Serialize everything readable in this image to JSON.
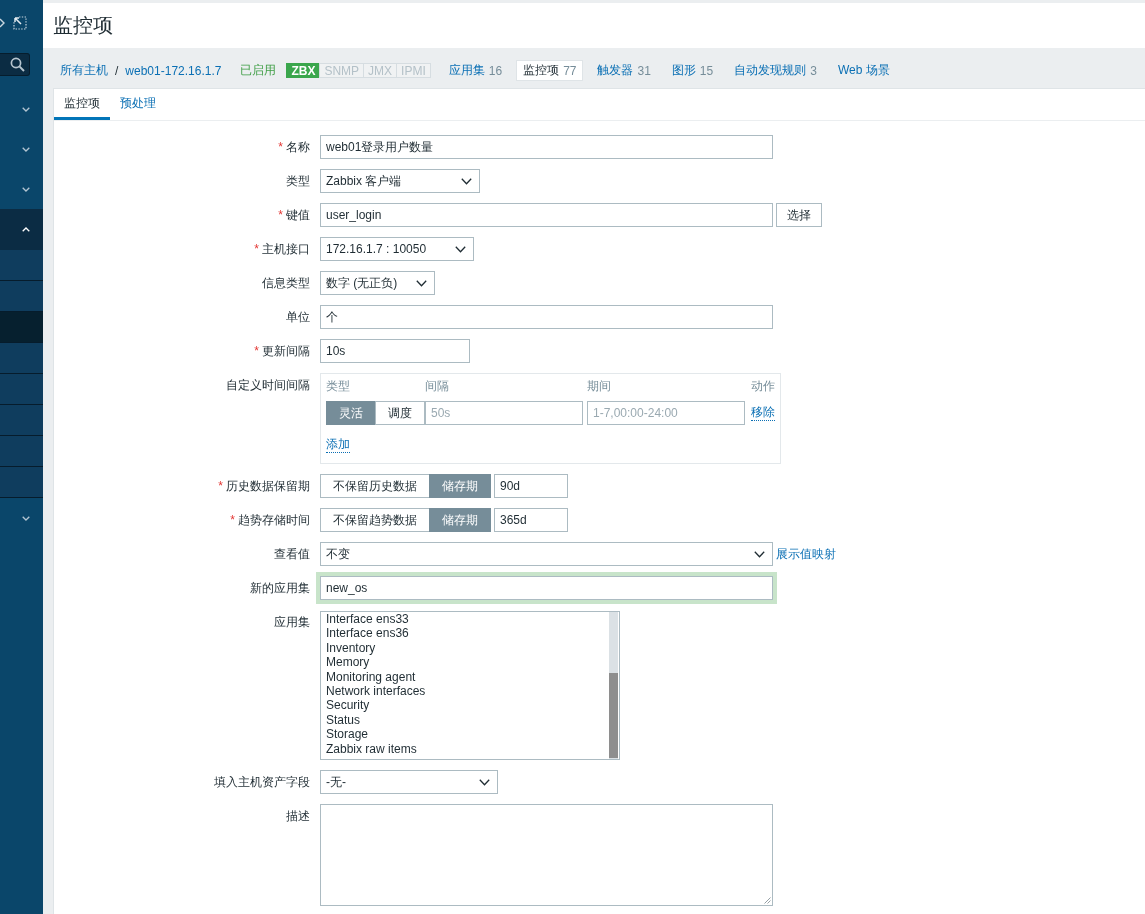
{
  "sidebar": {
    "sections": [
      {
        "expanded": false
      },
      {
        "expanded": false
      },
      {
        "expanded": false
      },
      {
        "expanded": true,
        "items": [
          {
            "selected": false
          },
          {
            "selected": false
          },
          {
            "selected": true
          },
          {
            "selected": false
          },
          {
            "selected": false
          },
          {
            "selected": false
          },
          {
            "selected": false
          },
          {
            "selected": false
          }
        ]
      },
      {
        "expanded": false
      }
    ]
  },
  "page_title": "监控项",
  "breadcrumbs": {
    "items": [
      "所有主机",
      "web01-172.16.1.7"
    ],
    "separator": "/"
  },
  "host_status": "已启用",
  "availability": [
    {
      "label": "ZBX",
      "active": true
    },
    {
      "label": "SNMP",
      "active": false
    },
    {
      "label": "JMX",
      "active": false
    },
    {
      "label": "IPMI",
      "active": false
    }
  ],
  "nav_tabs": [
    {
      "label": "应用集",
      "count": "16",
      "selected": false
    },
    {
      "label": "监控项",
      "count": "77",
      "selected": true
    },
    {
      "label": "触发器",
      "count": "31",
      "selected": false
    },
    {
      "label": "图形",
      "count": "15",
      "selected": false
    },
    {
      "label": "自动发现规则",
      "count": "3",
      "selected": false
    },
    {
      "label": "Web 场景",
      "selected": false
    }
  ],
  "tabs": [
    {
      "label": "监控项",
      "selected": true
    },
    {
      "label": "预处理",
      "selected": false
    }
  ],
  "fields": [
    {
      "kind": "text",
      "label": "名称",
      "required_mark": "*",
      "value": "web01登录用户数量",
      "focused": false
    },
    {
      "kind": "select",
      "label": "类型",
      "value": "Zabbix 客户端"
    },
    {
      "kind": "text",
      "label": "键值",
      "required_mark": "*",
      "value": "user_login",
      "focused": false,
      "button": "选择"
    },
    {
      "kind": "select",
      "label": "主机接口",
      "required_mark": "*",
      "value": "172.16.1.7 : 10050"
    },
    {
      "kind": "select",
      "label": "信息类型",
      "value": "数字 (无正负)"
    },
    {
      "kind": "text",
      "label": "单位",
      "value": "个",
      "focused": false
    },
    {
      "kind": "text",
      "label": "更新间隔",
      "required_mark": "*",
      "value": "10s",
      "focused": false
    },
    {
      "kind": "intervals",
      "label": "自定义时间间隔",
      "columns": [
        "类型",
        "间隔",
        "期间",
        "动作"
      ],
      "rows": [
        {
          "modes": [
            {
              "label": "灵活",
              "selected": true
            },
            {
              "label": "调度",
              "selected": false
            }
          ],
          "interval_placeholder": "50s",
          "period_placeholder": "1-7,00:00-24:00",
          "remove_link": "移除"
        }
      ],
      "add_link": "添加"
    },
    {
      "kind": "storage",
      "label": "历史数据保留期",
      "required_mark": "*",
      "options": [
        {
          "label": "不保留历史数据",
          "selected": false
        },
        {
          "label": "储存期",
          "selected": true
        }
      ],
      "value": "90d"
    },
    {
      "kind": "storage",
      "label": "趋势存储时间",
      "required_mark": "*",
      "options": [
        {
          "label": "不保留趋势数据",
          "selected": false
        },
        {
          "label": "储存期",
          "selected": true
        }
      ],
      "value": "365d"
    },
    {
      "kind": "select",
      "label": "查看值",
      "value": "不变",
      "link": "展示值映射"
    },
    {
      "kind": "text",
      "label": "新的应用集",
      "value": "new_os",
      "focused": true
    },
    {
      "kind": "listbox",
      "label": "应用集",
      "options": [
        {
          "label": "Interface ens33",
          "selected": false
        },
        {
          "label": "Interface ens36",
          "selected": false
        },
        {
          "label": "Inventory",
          "selected": false
        },
        {
          "label": "Memory",
          "selected": false
        },
        {
          "label": "Monitoring agent",
          "selected": false
        },
        {
          "label": "Network interfaces",
          "selected": false
        },
        {
          "label": "Security",
          "selected": false
        },
        {
          "label": "Status",
          "selected": false
        },
        {
          "label": "Storage",
          "selected": false
        },
        {
          "label": "Zabbix raw items",
          "selected": false
        }
      ]
    },
    {
      "kind": "select",
      "label": "填入主机资产字段",
      "value": "-无-"
    },
    {
      "kind": "textarea",
      "label": "描述"
    }
  ]
}
